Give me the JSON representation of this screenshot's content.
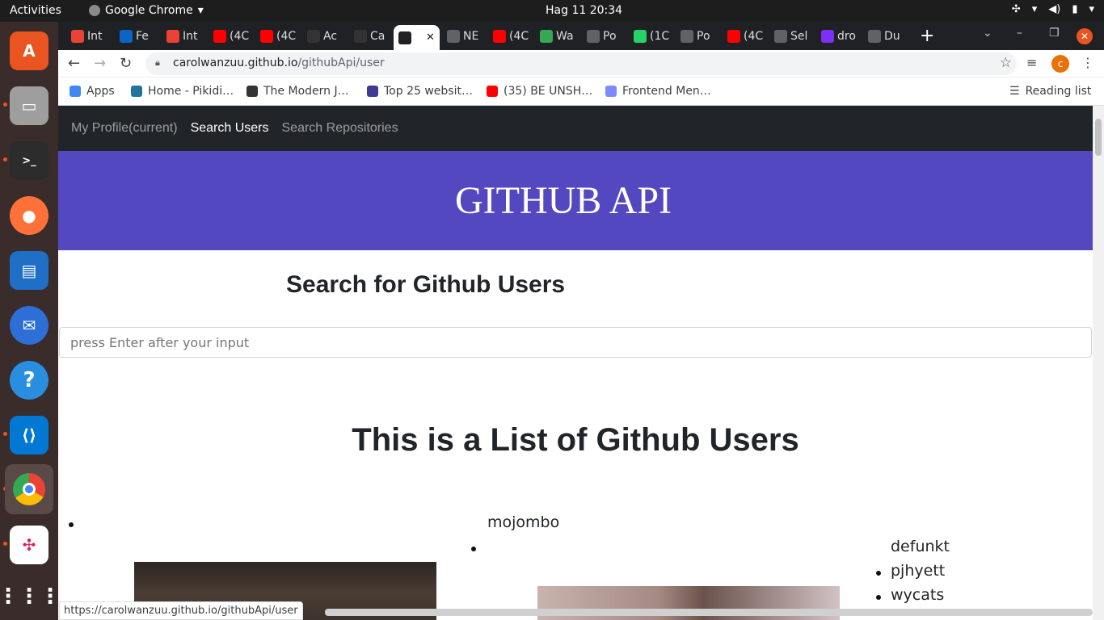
{
  "system": {
    "activities": "Activities",
    "app_name": "Google Chrome",
    "clock": "Hag 11  20:34"
  },
  "tabs": [
    {
      "label": "Int",
      "icon": "gmail-icon",
      "color": "#ea4335"
    },
    {
      "label": "Fe",
      "icon": "linkedin-icon",
      "color": "#0a66c2"
    },
    {
      "label": "Int",
      "icon": "gmail-icon",
      "color": "#ea4335"
    },
    {
      "label": "(4C",
      "icon": "youtube-icon",
      "color": "#ff0000"
    },
    {
      "label": "(4C",
      "icon": "youtube-icon",
      "color": "#ff0000"
    },
    {
      "label": "Ac",
      "icon": "github-icon",
      "color": "#333333"
    },
    {
      "label": "Ca",
      "icon": "github-icon",
      "color": "#333333"
    },
    {
      "label": "",
      "icon": "angular-icon",
      "color": "#202124",
      "active": true
    },
    {
      "label": "NE",
      "icon": "globe-icon",
      "color": "#5f6368"
    },
    {
      "label": "(4C",
      "icon": "youtube-icon",
      "color": "#ff0000"
    },
    {
      "label": "Wa",
      "icon": "play-icon",
      "color": "#34a853"
    },
    {
      "label": "Po",
      "icon": "globe-icon",
      "color": "#5f6368"
    },
    {
      "label": "(1C",
      "icon": "whatsapp-icon",
      "color": "#25d366"
    },
    {
      "label": "Po",
      "icon": "globe-icon",
      "color": "#5f6368"
    },
    {
      "label": "(4C",
      "icon": "youtube-icon",
      "color": "#ff0000"
    },
    {
      "label": "Sel",
      "icon": "globe-icon",
      "color": "#5f6368"
    },
    {
      "label": "dro",
      "icon": "h-icon",
      "color": "#7b2ff7"
    },
    {
      "label": "Du",
      "icon": "globe-icon",
      "color": "#5f6368"
    }
  ],
  "address": {
    "host": "carolwanzuu.github.io",
    "path": "/githubApi/user"
  },
  "profile_initial": "c",
  "bookmarks": [
    {
      "label": "Apps",
      "icon": "apps-grid-icon",
      "color": "#4285f4"
    },
    {
      "label": "Home - Pikidi…",
      "icon": "wordpress-icon",
      "color": "#21759b"
    },
    {
      "label": "The Modern J…",
      "icon": "modern-js-icon",
      "color": "#333333"
    },
    {
      "label": "Top 25 websit…",
      "icon": "tds-icon",
      "color": "#3b3b8f"
    },
    {
      "label": "(35) BE UNSH…",
      "icon": "youtube-icon",
      "color": "#ff0000"
    },
    {
      "label": "Frontend Men…",
      "icon": "frontend-mentor-icon",
      "color": "#7e8aff"
    }
  ],
  "reading_list": "Reading list",
  "site": {
    "nav": [
      "My Profile(current)",
      "Search Users",
      "Search Repositories"
    ],
    "hero_title": "GITHUB API",
    "search_title": "Search for Github Users",
    "search_placeholder": "press Enter after your input",
    "list_title": "This is a List of Github Users",
    "users": [
      "mojombo",
      "defunkt",
      "pjhyett",
      "wycats"
    ]
  },
  "status_url": "https://carolwanzuu.github.io/githubApi/user"
}
